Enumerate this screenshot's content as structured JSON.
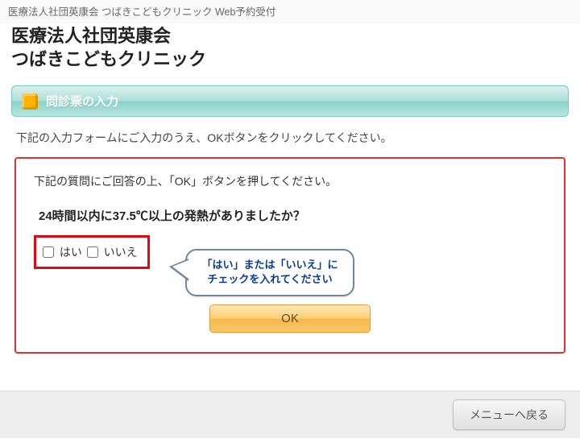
{
  "breadcrumb": "医療法人社団英康会 つばきこどもクリニック  Web予約受付",
  "header": {
    "line1": "医療法人社団英康会",
    "line2": "つばきこどもクリニック"
  },
  "section": {
    "icon": "cube-icon",
    "title": "問診票の入力"
  },
  "instruction": "下記の入力フォームにご入力のうえ、OKボタンをクリックしてください。",
  "panel": {
    "instruction": "下記の質問にご回答の上、「OK」ボタンを押してください。",
    "question": "24時間以内に37.5℃以上の発熱がありましたか？",
    "answers": {
      "yes": "はい",
      "no": "いいえ"
    },
    "bubble": {
      "line1": "「はい」または「いいえ」に",
      "line2": "チェックを入れてください"
    },
    "ok_label": "OK"
  },
  "footer": {
    "back_label": "メニューへ戻る"
  }
}
